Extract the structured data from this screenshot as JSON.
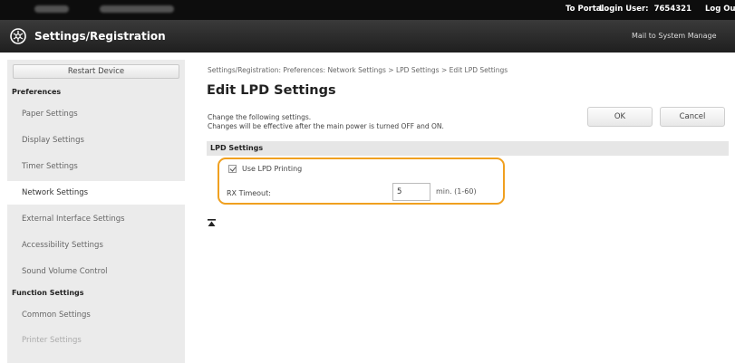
{
  "topbar": {
    "portal_link": "To Portal",
    "login_label": "Login User:",
    "login_user_id": "7654321",
    "logout_label": "Log Ou"
  },
  "header": {
    "title": "Settings/Registration",
    "mail_link": "Mail to System Manage"
  },
  "sidebar": {
    "restart_button": "Restart Device",
    "preferences_heading": "Preferences",
    "items": [
      {
        "label": "Paper Settings"
      },
      {
        "label": "Display Settings"
      },
      {
        "label": "Timer Settings"
      },
      {
        "label": "Network Settings",
        "active": true
      },
      {
        "label": "External Interface Settings"
      },
      {
        "label": "Accessibility Settings"
      },
      {
        "label": "Sound Volume Control"
      }
    ],
    "function_heading": "Function Settings",
    "function_items": [
      {
        "label": "Common Settings"
      },
      {
        "label": "Printer Settings"
      }
    ]
  },
  "main": {
    "breadcrumb": "Settings/Registration: Preferences: Network Settings > LPD Settings > Edit LPD Settings",
    "page_title": "Edit LPD Settings",
    "instruction_line1": "Change the following settings.",
    "instruction_line2": "Changes will be effective after the main power is turned OFF and ON.",
    "ok_label": "OK",
    "cancel_label": "Cancel",
    "section_title": "LPD Settings",
    "use_lpd_label": "Use LPD Printing",
    "use_lpd_checked": true,
    "rx_timeout_label": "RX Timeout:",
    "rx_timeout_value": "5",
    "rx_timeout_unit": "min. (1-60)"
  },
  "colors": {
    "highlight": "#f0a020",
    "header_bg": "#2a2a2a",
    "sidebar_bg": "#ebebeb"
  },
  "icons": [
    "settings-logo-icon",
    "back-to-top-icon",
    "checkbox-checked-icon"
  ]
}
